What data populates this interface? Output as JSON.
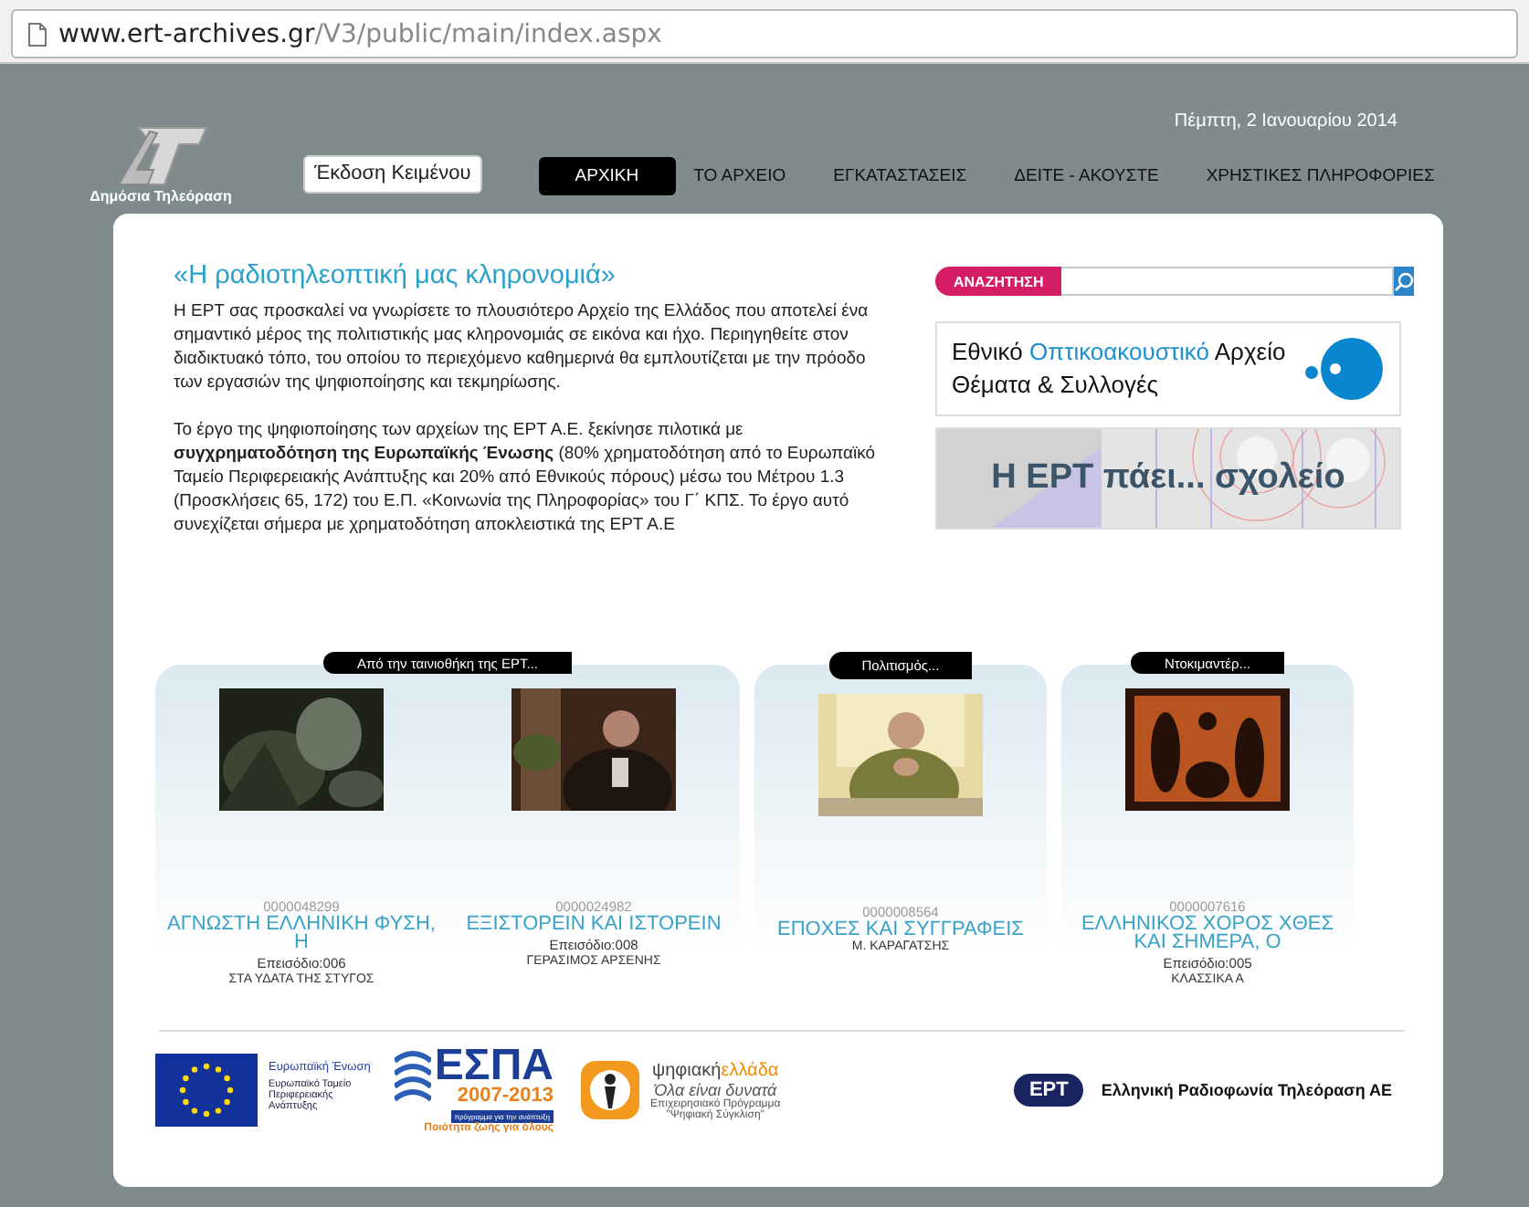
{
  "address_bar": {
    "host": "www.ert-archives.gr",
    "path": "/V3/public/main/index.aspx"
  },
  "logo": {
    "caption": "Δημόσια Τηλεόραση"
  },
  "text_version_button": "Έκδοση Κειμένου",
  "date": "Πέμπτη, 2 Ιανουαρίου 2014",
  "nav": [
    {
      "label": "ΑΡΧΙΚΗ",
      "selected": true
    },
    {
      "label": "ΤΟ ΑΡΧΕΙΟ",
      "selected": false
    },
    {
      "label": "ΕΓΚΑΤΑΣΤΑΣΕΙΣ",
      "selected": false
    },
    {
      "label": "ΔΕΙΤΕ - ΑΚΟΥΣΤΕ",
      "selected": false
    },
    {
      "label": "ΧΡΗΣΤΙΚΕΣ ΠΛΗΡΟΦΟΡΙΕΣ",
      "selected": false
    }
  ],
  "intro": {
    "title": "«Η ραδιοτηλεοπτική μας κληρονομιά»",
    "paragraphs": [
      "Η ΕΡΤ σας προσκαλεί να γνωρίσετε το πλουσιότερο Αρχείο της Ελλάδος που αποτελεί ένα σημαντικό μέρος της πολιτιστικής μας κληρονομιάς σε εικόνα και ήχο. Περιηγηθείτε στον διαδικτυακό τόπο, του οποίου το περιεχόμενο καθημερινά θα εμπλουτίζεται με την πρόοδο των εργασιών της ψηφιοποίησης και τεκμηρίωσης.",
      "Το έργο της ψηφιοποίησης των αρχείων της ΕΡΤ Α.Ε. ξεκίνησε πιλοτικά με **συγχρηματοδότηση της Ευρωπαϊκής Ένωσης** (80% χρηματοδότηση από το Ευρωπαϊκό Ταμείο Περιφερειακής Ανάπτυξης και 20% από Εθνικούς πόρους) μέσω του Μέτρου 1.3 (Προσκλήσεις 65, 172) του Ε.Π. «Κοινωνία της Πληροφορίας» του Γ΄ ΚΠΣ. Το έργο αυτό συνεχίζεται σήμερα με χρηματοδότηση αποκλειστικά της ΕΡΤ Α.Ε"
    ]
  },
  "search": {
    "label": "ΑΝΑΖΗΤΗΣΗ"
  },
  "banners": [
    {
      "kind": "archive",
      "title_start": "Εθνικό",
      "title_highlight": "Οπτικοακουστικό",
      "title_end": "Αρχείο",
      "subtitle": "Θέματα & Συλλογές"
    },
    {
      "kind": "school",
      "title": "Η ΕΡΤ πάει... σχολείο"
    }
  ],
  "video_groups": [
    {
      "heading": "Από την ταινιοθήκη της ΕΡΤ...",
      "items": [
        {
          "code": "0000048299",
          "title": "ΑΓΝΩΣΤΗ ΕΛΛΗΝΙΚΗ ΦΥΣΗ, Η",
          "episode": "Επεισόδιο:006",
          "subtitle": "ΣΤΑ ΥΔΑΤΑ ΤΗΣ ΣΤΥΓΟΣ"
        },
        {
          "code": "0000024982",
          "title": "ΕΞΙΣΤΟΡΕΙΝ ΚΑΙ ΙΣΤΟΡΕΙΝ",
          "episode": "Επεισόδιο:008",
          "subtitle": "ΓΕΡΑΣΙΜΟΣ ΑΡΣΕΝΗΣ"
        }
      ]
    },
    {
      "heading": "Πολιτισμός...",
      "items": [
        {
          "code": "0000008564",
          "title": "ΕΠΟΧΕΣ ΚΑΙ ΣΥΓΓΡΑΦΕΙΣ",
          "subtitle": "Μ. ΚΑΡΑΓΑΤΣΗΣ"
        }
      ]
    },
    {
      "heading": "Ντοκιμαντέρ...",
      "items": [
        {
          "code": "0000007616",
          "title": "ΕΛΛΗΝΙΚΟΣ ΧΟΡΟΣ ΧΘΕΣ ΚΑΙ ΣΗΜΕΡΑ, Ο",
          "episode": "Επεισόδιο:005",
          "subtitle": "ΚΛΑΣΣΙΚΑ Α"
        }
      ]
    }
  ],
  "footer": {
    "eu": {
      "title": "Ευρωπαϊκή Ένωση",
      "text": "Ευρωπαϊκό Ταμείο Περιφερειακής Ανάπτυξης"
    },
    "espa": {
      "title": "ΕΣΠΑ",
      "years": "2007-2013",
      "tag": "πρόγραμμα για την ανάπτυξη",
      "motto": "Ποιότητα ζωής για όλους"
    },
    "digital": {
      "title_start": "ψηφιακή",
      "title_end": "ελλάδα",
      "motto": "Όλα είναι δυνατά",
      "program": "Επιχειρησιακό Πρόγραμμα",
      "name": "\"Ψηφιακή Σύγκλιση\""
    },
    "ert": {
      "badge": "ΕΡΤ",
      "name": "Ελληνική Ραδιοφωνία Τηλεόραση ΑΕ"
    }
  }
}
